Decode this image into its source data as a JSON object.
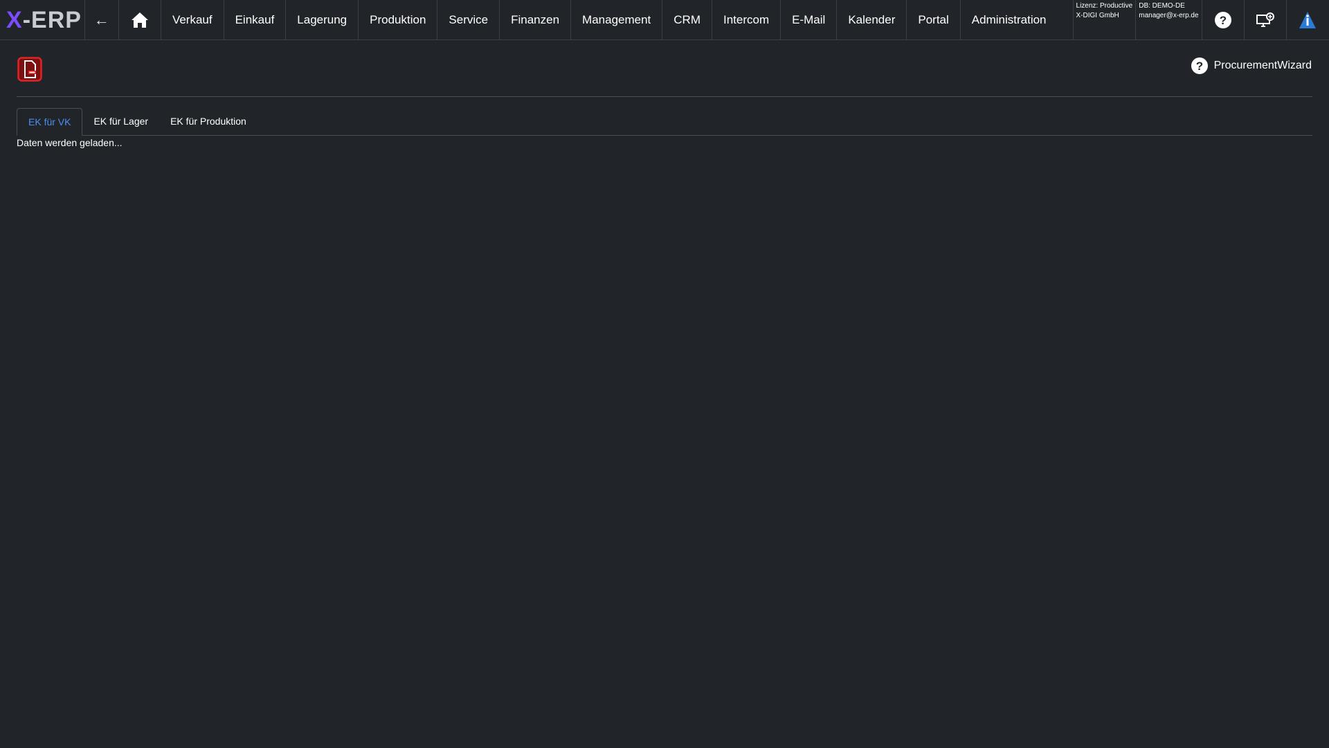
{
  "app": {
    "logo_x": "X",
    "logo_rest": "-ERP"
  },
  "nav": {
    "back_label": "←",
    "items": [
      {
        "label": "Verkauf"
      },
      {
        "label": "Einkauf"
      },
      {
        "label": "Lagerung"
      },
      {
        "label": "Produktion"
      },
      {
        "label": "Service"
      },
      {
        "label": "Finanzen"
      },
      {
        "label": "Management"
      },
      {
        "label": "CRM"
      },
      {
        "label": "Intercom"
      },
      {
        "label": "E-Mail"
      },
      {
        "label": "Kalender"
      },
      {
        "label": "Portal"
      },
      {
        "label": "Administration"
      }
    ]
  },
  "license": {
    "line1": "Lizenz: Productive",
    "line2": "X-DIGI GmbH"
  },
  "db": {
    "line1": "DB: DEMO-DE",
    "line2": "manager@x-erp.de"
  },
  "icons": {
    "page_icon": "document-remove-icon",
    "help": "help-circle-icon",
    "remote": "remote-desktop-icon",
    "info": "info-triangle-icon",
    "home": "home-icon"
  },
  "wizard": {
    "label": "ProcurementWizard"
  },
  "tabs": [
    {
      "label": "EK für VK",
      "active": true
    },
    {
      "label": "EK für Lager",
      "active": false
    },
    {
      "label": "EK für Produktion",
      "active": false
    }
  ],
  "content": {
    "status_text": "Daten werden geladen..."
  },
  "colors": {
    "background": "#212529",
    "logo_accent": "#7c4dff",
    "active_tab": "#4a90f0",
    "page_icon": "#e02424",
    "info_icon": "#2b7bd4"
  }
}
